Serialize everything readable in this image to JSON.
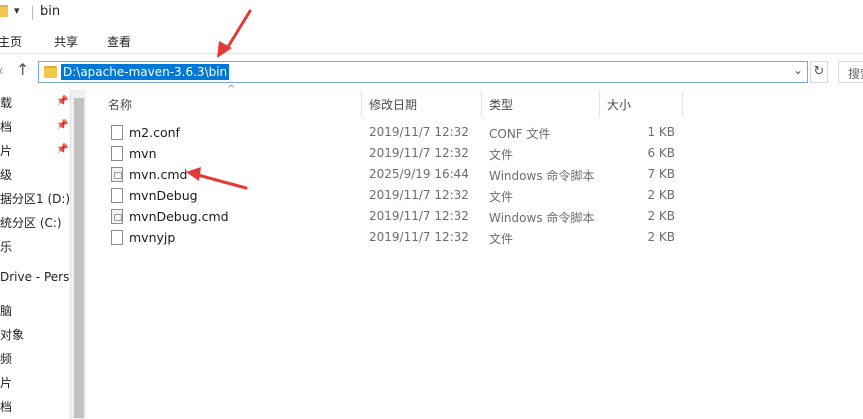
{
  "window": {
    "title": "bin",
    "quick_access_toggle": "▾"
  },
  "ribbon": {
    "tabs": [
      {
        "label": "主页"
      },
      {
        "label": "共享"
      },
      {
        "label": "查看"
      }
    ]
  },
  "address": {
    "path": "D:\\apache-maven-3.6.3\\bin",
    "search_placeholder": "搜索\"bin\""
  },
  "nav_pane": {
    "items": [
      {
        "label": "载",
        "pinned": true
      },
      {
        "label": "档",
        "pinned": true
      },
      {
        "label": "片",
        "pinned": true
      },
      {
        "label": "级",
        "pinned": false
      },
      {
        "label": "据分区1 (D:)",
        "pinned": false
      },
      {
        "label": "统分区 (C:)",
        "pinned": false
      },
      {
        "label": "乐",
        "pinned": false
      },
      {
        "label": "Drive - Personal",
        "pinned": false
      },
      {
        "label": "脑",
        "pinned": false
      },
      {
        "label": " 对象",
        "pinned": false
      },
      {
        "label": "频",
        "pinned": false
      },
      {
        "label": "片",
        "pinned": false
      },
      {
        "label": "档",
        "pinned": false
      }
    ]
  },
  "file_list": {
    "columns": {
      "name": "名称",
      "modified": "修改日期",
      "type": "类型",
      "size": "大小"
    },
    "files": [
      {
        "name": "m2.conf",
        "modified": "2019/11/7 12:32",
        "type": "CONF 文件",
        "size": "1 KB",
        "icon": "file-icon"
      },
      {
        "name": "mvn",
        "modified": "2019/11/7 12:32",
        "type": "文件",
        "size": "6 KB",
        "icon": "file-icon"
      },
      {
        "name": "mvn.cmd",
        "modified": "2025/9/19 16:44",
        "type": "Windows 命令脚本",
        "size": "7 KB",
        "icon": "cmd-script-icon"
      },
      {
        "name": "mvnDebug",
        "modified": "2019/11/7 12:32",
        "type": "文件",
        "size": "2 KB",
        "icon": "file-icon"
      },
      {
        "name": "mvnDebug.cmd",
        "modified": "2019/11/7 12:32",
        "type": "Windows 命令脚本",
        "size": "2 KB",
        "icon": "cmd-script-icon"
      },
      {
        "name": "mvnyjp",
        "modified": "2019/11/7 12:32",
        "type": "文件",
        "size": "2 KB",
        "icon": "file-icon"
      }
    ]
  },
  "colors": {
    "selection": "#0078d7",
    "annotation_arrow": "#e53935",
    "folder": "#f2c94c"
  }
}
